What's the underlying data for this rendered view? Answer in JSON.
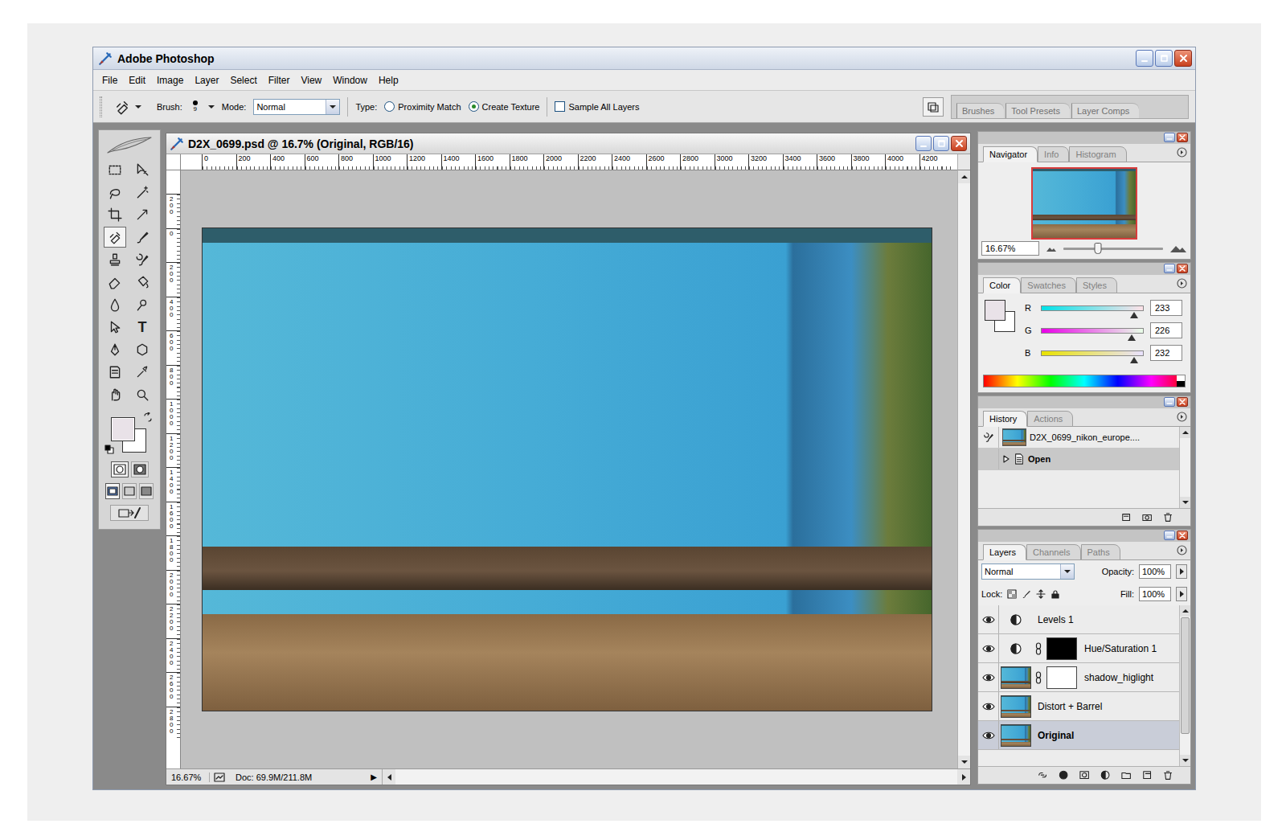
{
  "window": {
    "title": "Adobe Photoshop"
  },
  "menu": [
    "File",
    "Edit",
    "Image",
    "Layer",
    "Select",
    "Filter",
    "View",
    "Window",
    "Help"
  ],
  "options_bar": {
    "brush_label": "Brush:",
    "brush_size": "9",
    "mode_label": "Mode:",
    "mode": "Normal",
    "type_label": "Type:",
    "types": [
      {
        "label": "Proximity Match",
        "selected": false
      },
      {
        "label": "Create Texture",
        "selected": true
      }
    ],
    "sample_all_layers": {
      "label": "Sample All Layers",
      "checked": false
    },
    "palette_well": [
      "Brushes",
      "Tool Presets",
      "Layer Comps"
    ]
  },
  "toolbox": {
    "tools": [
      {
        "selected": false
      },
      {
        "selected": false
      },
      {
        "selected": false
      },
      {
        "selected": false
      },
      {
        "selected": false
      },
      {
        "selected": false
      },
      {
        "selected": true
      },
      {
        "selected": false
      },
      {
        "selected": false
      },
      {
        "selected": false
      },
      {
        "selected": false
      },
      {
        "selected": false
      },
      {
        "selected": false
      },
      {
        "selected": false
      },
      {
        "selected": false
      },
      {
        "selected": false,
        "glyph": "T"
      },
      {
        "selected": false
      },
      {
        "selected": false
      },
      {
        "selected": false
      },
      {
        "selected": false
      },
      {
        "selected": false
      },
      {
        "selected": false
      }
    ]
  },
  "document": {
    "title": "D2X_0699.psd @ 16.7% (Original, RGB/16)",
    "ruler_h": [
      "0",
      "200",
      "400",
      "600",
      "800",
      "1000",
      "1200",
      "1400",
      "1600",
      "1800",
      "2000",
      "2200",
      "2400",
      "2600",
      "2800",
      "3000",
      "3200",
      "3400",
      "3600",
      "3800",
      "4000",
      "4200"
    ],
    "ruler_v": [
      "200",
      "0",
      "200",
      "400",
      "600",
      "800",
      "1000",
      "1200",
      "1400",
      "1600",
      "1800",
      "2000",
      "2200",
      "2400",
      "2600",
      "2800"
    ],
    "zoom": "16.67%",
    "doc_size": "Doc: 69.9M/211.8M",
    "status_arrow": "▶"
  },
  "navigator": {
    "tabs": [
      {
        "label": "Navigator",
        "selected": true
      },
      {
        "label": "Info",
        "selected": false
      },
      {
        "label": "Histogram",
        "selected": false
      }
    ],
    "zoom": "16.67%",
    "level": 0.35
  },
  "color": {
    "tabs": [
      {
        "label": "Color",
        "selected": true
      },
      {
        "label": "Swatches",
        "selected": false
      },
      {
        "label": "Styles",
        "selected": false
      }
    ],
    "foreground": "#e9e2e8",
    "background": "#ffffff",
    "channels": [
      {
        "name": "R",
        "value": "233",
        "level": 0.914
      },
      {
        "name": "G",
        "value": "226",
        "level": 0.886
      },
      {
        "name": "B",
        "value": "232",
        "level": 0.91
      }
    ]
  },
  "history": {
    "tabs": [
      {
        "label": "History",
        "selected": true
      },
      {
        "label": "Actions",
        "selected": false
      }
    ],
    "items": [
      {
        "label": "D2X_0699_nikon_europe....",
        "kind": "snapshot",
        "selected": false
      },
      {
        "label": "Open",
        "kind": "step",
        "selected": true
      }
    ]
  },
  "layers": {
    "tabs": [
      {
        "label": "Layers",
        "selected": true
      },
      {
        "label": "Channels",
        "selected": false
      },
      {
        "label": "Paths",
        "selected": false
      }
    ],
    "blend_mode": "Normal",
    "opacity_label": "Opacity:",
    "opacity": "100%",
    "lock_label": "Lock:",
    "fill_label": "Fill:",
    "fill": "100%",
    "scroll_thumb": 0.85,
    "items": [
      {
        "name": "Levels 1",
        "kind": "adjustment",
        "visible": true,
        "selected": false
      },
      {
        "name": "Hue/Saturation 1",
        "kind": "adjustment-mask",
        "visible": true,
        "selected": false,
        "mask": "#000000"
      },
      {
        "name": "shadow_higlight",
        "kind": "image-mask",
        "visible": true,
        "selected": false,
        "mask": "#ffffff"
      },
      {
        "name": "Distort + Barrel",
        "kind": "image",
        "visible": true,
        "selected": false
      },
      {
        "name": "Original",
        "kind": "image",
        "visible": true,
        "selected": true
      }
    ]
  }
}
